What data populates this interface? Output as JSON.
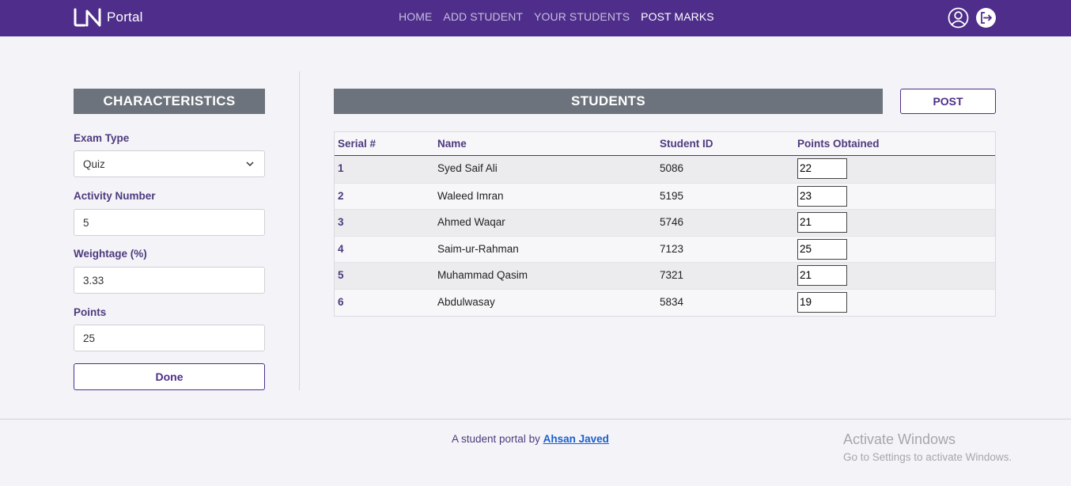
{
  "nav": {
    "brand": "Portal",
    "links": [
      {
        "label": "HOME",
        "active": false
      },
      {
        "label": "ADD STUDENT",
        "active": false
      },
      {
        "label": "YOUR STUDENTS",
        "active": false
      },
      {
        "label": "POST MARKS",
        "active": true
      }
    ],
    "icons": [
      "user-circle-icon",
      "logout-icon"
    ]
  },
  "characteristics": {
    "title": "CHARACTERISTICS",
    "exam_type_label": "Exam Type",
    "exam_type_value": "Quiz",
    "activity_label": "Activity Number",
    "activity_value": "5",
    "weightage_label": "Weightage (%)",
    "weightage_value": "3.33",
    "points_label": "Points",
    "points_value": "25",
    "done_label": "Done"
  },
  "students": {
    "title": "STUDENTS",
    "post_label": "POST",
    "columns": [
      "Serial #",
      "Name",
      "Student ID",
      "Points Obtained"
    ],
    "rows": [
      {
        "serial": "1",
        "name": "Syed Saif Ali",
        "id": "5086",
        "points": "22"
      },
      {
        "serial": "2",
        "name": "Waleed Imran",
        "id": "5195",
        "points": "23"
      },
      {
        "serial": "3",
        "name": "Ahmed Waqar",
        "id": "5746",
        "points": "21"
      },
      {
        "serial": "4",
        "name": "Saim-ur-Rahman",
        "id": "7123",
        "points": "25"
      },
      {
        "serial": "5",
        "name": "Muhammad Qasim",
        "id": "7321",
        "points": "21"
      },
      {
        "serial": "6",
        "name": "Abdulwasay",
        "id": "5834",
        "points": "19"
      }
    ]
  },
  "footer": {
    "text": "A student portal by",
    "author": "Ahsan Javed"
  },
  "watermark": {
    "title": "Activate Windows",
    "subtitle": "Go to Settings to activate Windows."
  },
  "colors": {
    "nav_bg": "#4e2e8a",
    "header_bg": "#6c737c",
    "accent": "#4e3a7e",
    "link": "#1a5fd0"
  }
}
